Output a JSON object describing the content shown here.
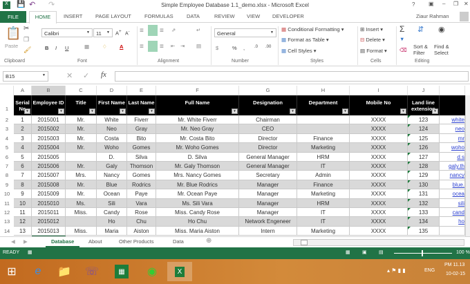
{
  "window": {
    "title": "Simple Employee Database 1.1_demo.xlsx - Microsoft Excel",
    "user": "Ziaur Rahman"
  },
  "ribbon_tabs": [
    "FILE",
    "HOME",
    "INSERT",
    "PAGE LAYOUT",
    "FORMULAS",
    "DATA",
    "REVIEW",
    "VIEW",
    "DEVELOPER"
  ],
  "ribbon": {
    "paste": "Paste",
    "font_name": "Calibri",
    "font_size": "11",
    "number_format": "General",
    "conditional_formatting": "Conditional Formatting",
    "format_as_table": "Format as Table",
    "cell_styles": "Cell Styles",
    "insert": "Insert",
    "delete": "Delete",
    "format": "Format",
    "sort_filter": "Sort & Filter",
    "find_select": "Find & Select",
    "groups": [
      "Clipboard",
      "Font",
      "Alignment",
      "Number",
      "Styles",
      "Cells",
      "Editing"
    ]
  },
  "formula_bar": {
    "name_box": "B15",
    "fx": "fx",
    "value": ""
  },
  "columns": [
    "A",
    "B",
    "C",
    "D",
    "E",
    "F",
    "G",
    "H",
    "I",
    "J"
  ],
  "headers": [
    "Serial No",
    "Employee ID",
    "Title",
    "First Name",
    "Last Name",
    "Full Name",
    "Designation",
    "Department",
    "Mobile No",
    "Land line extension"
  ],
  "rows": [
    [
      "1",
      "2015001",
      "Mr.",
      "White",
      "Fiverr",
      "Mr. White Fiverr",
      "Chairman",
      "",
      "XXXX",
      "123",
      "white"
    ],
    [
      "2",
      "2015002",
      "Mr.",
      "Neo",
      "Gray",
      "Mr. Neo Gray",
      "CEO",
      "",
      "XXXX",
      "124",
      "neo"
    ],
    [
      "3",
      "2015003",
      "Mr.",
      "Costa",
      "Bito",
      "Mr. Costa Bito",
      "Director",
      "Finance",
      "XXXX",
      "125",
      "mr"
    ],
    [
      "4",
      "2015004",
      "Mr.",
      "Woho",
      "Gomes",
      "Mr. Woho Gomes",
      "Director",
      "Marketing",
      "XXXX",
      "126",
      "woho"
    ],
    [
      "5",
      "2015005",
      "",
      "D.",
      "Silva",
      "D. Silva",
      "General Manager",
      "HRM",
      "XXXX",
      "127",
      "d.s"
    ],
    [
      "6",
      "2015006",
      "Mr.",
      "Galy",
      "Thomson",
      "Mr. Galy Thomson",
      "General Manager",
      "IT",
      "XXXX",
      "128",
      "galy.th"
    ],
    [
      "7",
      "2015007",
      "Mrs.",
      "Nancy",
      "Gomes",
      "Mrs. Nancy Gomes",
      "Secretary",
      "Admin",
      "XXXX",
      "129",
      "nancy"
    ],
    [
      "8",
      "2015008",
      "Mr.",
      "Blue",
      "Rodrics",
      "Mr. Blue Rodrics",
      "Manager",
      "Finance",
      "XXXX",
      "130",
      "blue."
    ],
    [
      "9",
      "2015009",
      "Mr.",
      "Ocean",
      "Paye",
      "Mr. Ocean Paye",
      "Manager",
      "Marketing",
      "XXXX",
      "131",
      "ocea"
    ],
    [
      "10",
      "2015010",
      "Ms.",
      "Sili",
      "Vara",
      "Ms. Sili Vara",
      "Manager",
      "HRM",
      "XXXX",
      "132",
      "sili"
    ],
    [
      "11",
      "2015011",
      "Miss.",
      "Candy",
      "Rose",
      "Miss. Candy Rose",
      "Manager",
      "IT",
      "XXXX",
      "133",
      "cand"
    ],
    [
      "12",
      "2015012",
      "",
      "Ho",
      "Chu",
      "Ho Chu",
      "Network Engeneer",
      "IT",
      "XXXX",
      "134",
      "ho"
    ],
    [
      "13",
      "2015013",
      "Miss.",
      "Maria",
      "Aiston",
      "Miss. Maria Aiston",
      "Intern",
      "Marketing",
      "XXXX",
      "135",
      ""
    ]
  ],
  "sheet_tabs": [
    "Database",
    "About",
    "Other Products",
    "Data"
  ],
  "status": {
    "ready": "READY",
    "zoom": "100 %"
  },
  "taskbar": {
    "lang": "ENG",
    "time": "PM 11.13",
    "date": "10-02-15"
  },
  "colors": {
    "excel_green": "#217346",
    "header_black": "#000000",
    "band_gray": "#d9d9d9"
  }
}
